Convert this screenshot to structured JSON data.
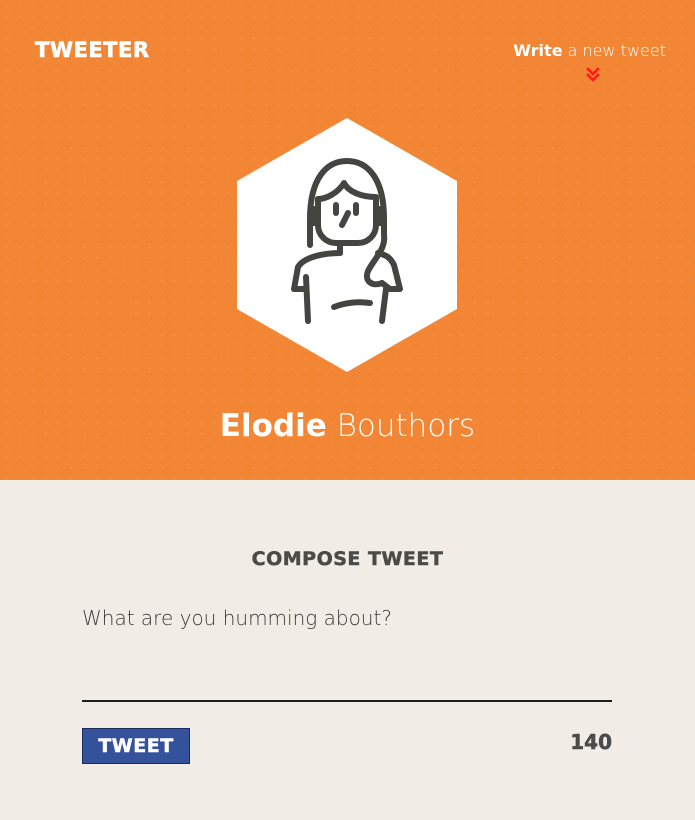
{
  "header": {
    "brand": "Tweeter",
    "nav": {
      "write_bold": "Write",
      "write_rest": " a new tweet",
      "chevron_icon": "double-chevron-down-icon"
    },
    "avatar_icon": "woman-avatar-icon",
    "profile": {
      "first_name": "Elodie",
      "last_name": " Bouthors"
    }
  },
  "compose": {
    "title": "Compose Tweet",
    "placeholder": "What are you humming about?",
    "value": "",
    "button_label": "Tweet",
    "char_count": "140"
  },
  "colors": {
    "header_bg": "#f28635",
    "page_bg": "#f1ede6",
    "button_bg": "#34519c",
    "chevron": "#ff1a1a",
    "text_dark": "#4a4a48"
  }
}
